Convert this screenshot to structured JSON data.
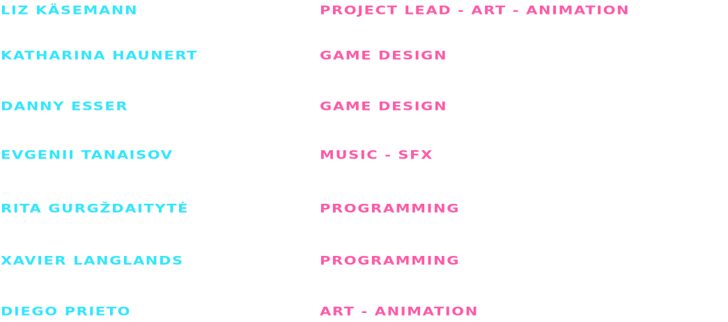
{
  "colors": {
    "name": "#33e6ff",
    "role": "#ff5aa8",
    "background": "#ffffff"
  },
  "credits": [
    {
      "name": "LIZ KÄSEMANN",
      "role": "PROJECT LEAD - ART - ANIMATION"
    },
    {
      "name": "KATHARINA HAUNERT",
      "role": "GAME DESIGN"
    },
    {
      "name": "DANNY ESSER",
      "role": "GAME DESIGN"
    },
    {
      "name": "EVGENII TANAISOV",
      "role": "MUSIC - SFX"
    },
    {
      "name": "RITA GURGŽDAITYTĖ",
      "role": "PROGRAMMING"
    },
    {
      "name": "XAVIER LANGLANDS",
      "role": "PROGRAMMING"
    },
    {
      "name": "DIEGO PRIETO",
      "role": "ART - ANIMATION"
    }
  ]
}
